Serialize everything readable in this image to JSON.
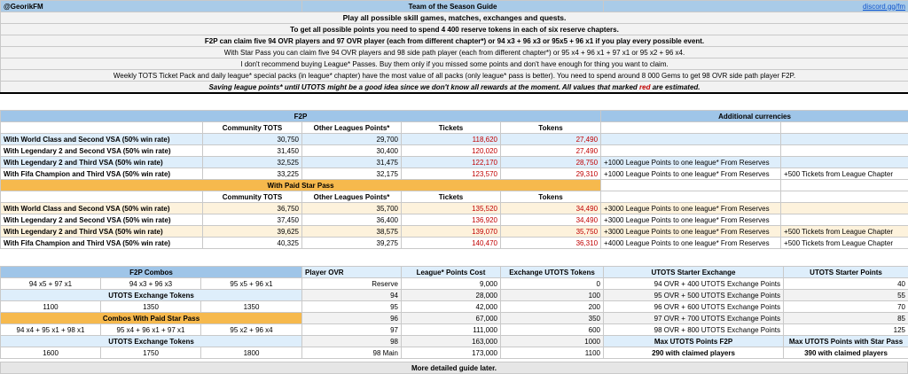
{
  "guide": {
    "author": "@GeorikFM",
    "title": "Team of the Season Guide",
    "link": "discord.gg/fm",
    "lines": [
      "Play all possible skill games, matches, exchanges and quests.",
      "To get all possible points you need to spend 4 400 reserve tokens in each of six reserve chapters.",
      "F2P can claim five 94 OVR players and 97 OVR player (each from different chapter*) or 94 x3 + 96 x3 or 95x5 + 96 x1 if you play every possible event.",
      "With Star Pass you can claim five 94 OVR players and 98 side path player (each from different chapter*) or 95 x4 + 96 x1 + 97 x1 or 95 x2 + 96 x4.",
      "I don't recommend buying League* Passes. Buy them only if you missed some points and don't have enough for thing you want to claim.",
      "Weekly TOTS Ticket Pack and daily league* special packs (in league* chapter) have the most value of all packs (only league* pass is better). You need to spend around 8 000 Gems to get 98 OVR side path player F2P."
    ],
    "note_before": "Saving league points* until UTOTS might be a good idea since we don't know all rewards at the moment. All values that marked ",
    "note_red": "red",
    "note_after": " are estimated."
  },
  "f2p": {
    "title": "F2P",
    "additional_title": "Additional currencies",
    "columns": [
      "Community TOTS",
      "Other Leagues Points*",
      "Tickets",
      "Tokens"
    ],
    "rows": [
      {
        "label": "With World Class and Second VSA (50% win rate)",
        "values": [
          "30,750",
          "29,700",
          "118,620",
          "27,490"
        ],
        "extra1": "",
        "extra2": ""
      },
      {
        "label": "With Legendary 2 and Second VSA (50% win rate)",
        "values": [
          "31,450",
          "30,400",
          "120,020",
          "27,490"
        ],
        "extra1": "",
        "extra2": ""
      },
      {
        "label": "With Legendary 2 and Third VSA (50% win rate)",
        "values": [
          "32,525",
          "31,475",
          "122,170",
          "28,750"
        ],
        "extra1": "+1000 League Points to one league* From Reserves",
        "extra2": ""
      },
      {
        "label": "With Fifa Champion and Third VSA (50% win rate)",
        "values": [
          "33,225",
          "32,175",
          "123,570",
          "29,310"
        ],
        "extra1": "+1000 League Points to one league* From Reserves",
        "extra2": "+500 Tickets from League Chapter"
      }
    ]
  },
  "paid": {
    "title": "With Paid Star Pass",
    "columns": [
      "Community TOTS",
      "Other Leagues Points*",
      "Tickets",
      "Tokens"
    ],
    "rows": [
      {
        "label": "With World Class and Second VSA (50% win rate)",
        "values": [
          "36,750",
          "35,700",
          "135,520",
          "34,490"
        ],
        "extra1": "+3000 League Points to one league* From Reserves",
        "extra2": ""
      },
      {
        "label": "With Legendary 2 and Second VSA (50% win rate)",
        "values": [
          "37,450",
          "36,400",
          "136,920",
          "34,490"
        ],
        "extra1": "+3000 League Points to one league* From Reserves",
        "extra2": ""
      },
      {
        "label": "With Legendary 2 and Third VSA (50% win rate)",
        "values": [
          "39,625",
          "38,575",
          "139,070",
          "35,750"
        ],
        "extra1": "+3000 League Points to one league* From Reserves",
        "extra2": "+500 Tickets from League Chapter"
      },
      {
        "label": "With Fifa Champion and Third VSA (50% win rate)",
        "values": [
          "40,325",
          "39,275",
          "140,470",
          "36,310"
        ],
        "extra1": "+4000 League Points to one league* From Reserves",
        "extra2": "+500 Tickets from League Chapter"
      }
    ]
  },
  "combos": {
    "f2p_title": "F2P Combos",
    "f2p": [
      "94 x5 + 97 x1",
      "94 x3 + 96 x3",
      "95 x5 + 96 x1"
    ],
    "tokens_title": "UTOTS Exchange Tokens",
    "f2p_tokens": [
      "1100",
      "1350",
      "1350"
    ],
    "paid_title": "Combos With Paid Star Pass",
    "paid": [
      "94 x4 + 95 x1 + 98 x1",
      "95 x4 + 96 x1 + 97 x1",
      "95 x2 + 96 x4"
    ],
    "paid_tokens": [
      "1600",
      "1750",
      "1800"
    ]
  },
  "ovr": {
    "headers": [
      "Player OVR",
      "League* Points Cost",
      "Exchange UTOTS Tokens"
    ],
    "rows": [
      [
        "Reserve",
        "9,000",
        "0"
      ],
      [
        "94",
        "28,000",
        "100"
      ],
      [
        "95",
        "42,000",
        "200"
      ],
      [
        "96",
        "67,000",
        "350"
      ],
      [
        "97",
        "111,000",
        "600"
      ],
      [
        "98",
        "163,000",
        "1000"
      ],
      [
        "98 Main",
        "173,000",
        "1100"
      ]
    ]
  },
  "starter": {
    "headers": [
      "UTOTS Starter Exchange",
      "UTOTS Starter Points"
    ],
    "rows": [
      [
        "94 OVR + 400 UTOTS Exchange Points",
        "40"
      ],
      [
        "95 OVR + 500 UTOTS Exchange Points",
        "55"
      ],
      [
        "96 OVR + 600 UTOTS Exchange Points",
        "70"
      ],
      [
        "97 OVR + 700 UTOTS Exchange Points",
        "85"
      ],
      [
        "98 OVR + 800 UTOTS Exchange Points",
        "125"
      ]
    ],
    "max_f2p_title": "Max UTOTS Points F2P",
    "max_star_title": "Max UTOTS Points with Star Pass",
    "max_f2p": "290 with claimed players",
    "max_star": "390 with claimed players"
  },
  "footer": "More detailed guide later."
}
